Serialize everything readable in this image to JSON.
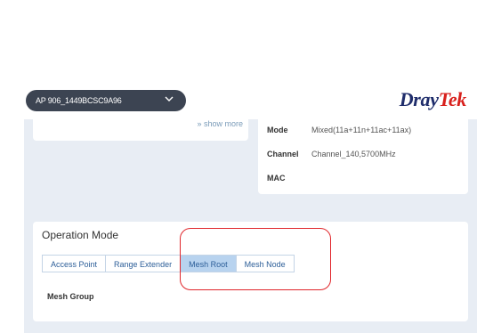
{
  "header": {
    "device_name": "AP 906_1449BCSC9A96",
    "brand_part1": "Dray",
    "brand_part2": "Tek",
    "colors": {
      "brand_navy": "#1f2d6b",
      "brand_red": "#d8201c",
      "select_bg": "#3c4452"
    }
  },
  "left_card": {
    "show_more": "show more"
  },
  "info": {
    "rows": [
      {
        "key": "Mode",
        "value": "Mixed(11a+11n+11ac+11ax)"
      },
      {
        "key": "Channel",
        "value": "Channel_140,5700MHz"
      },
      {
        "key": "MAC",
        "value": ""
      }
    ]
  },
  "operation_mode": {
    "title": "Operation Mode",
    "tabs": [
      {
        "label": "Access Point",
        "active": false
      },
      {
        "label": "Range Extender",
        "active": false
      },
      {
        "label": "Mesh Root",
        "active": true
      },
      {
        "label": "Mesh Node",
        "active": false
      }
    ],
    "mesh_group_label": "Mesh Group"
  },
  "annotation": {
    "highlight_color": "#e0262b"
  }
}
